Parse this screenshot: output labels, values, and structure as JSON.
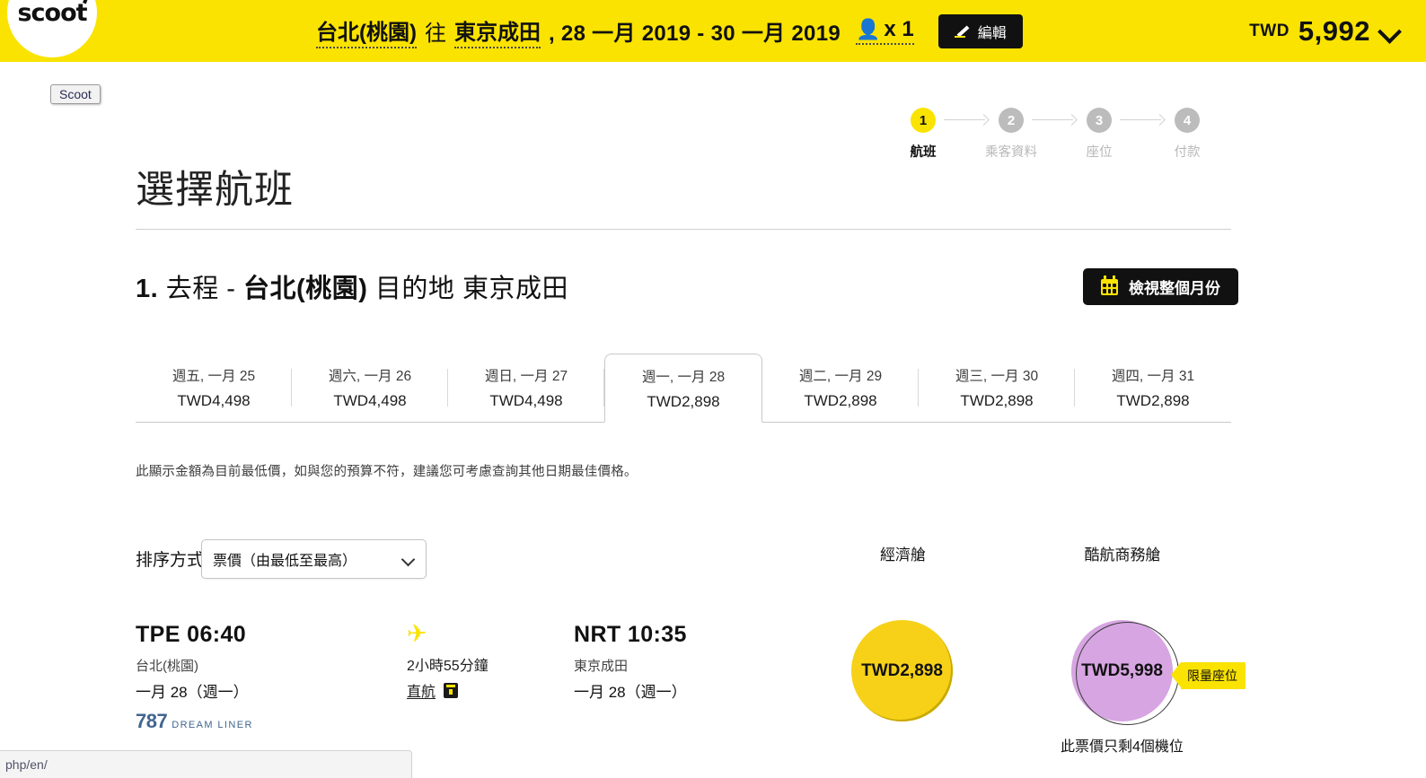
{
  "header": {
    "brand": "scoot",
    "origin": "台北(桃園)",
    "via": "往",
    "destination": "東京成田",
    "dates": ", 28 一月 2019 - 30 一月 2019",
    "pax_icon": "person-icon",
    "pax": "x 1",
    "edit_label": "編輯",
    "currency": "TWD",
    "total": "5,992",
    "chevron_icon": "chevron-down-icon"
  },
  "tooltip": {
    "text": "Scoot"
  },
  "stepper": {
    "steps": [
      {
        "num": "1",
        "label": "航班",
        "state": "active"
      },
      {
        "num": "2",
        "label": "乘客資料",
        "state": "idle"
      },
      {
        "num": "3",
        "label": "座位",
        "state": "idle"
      },
      {
        "num": "4",
        "label": "付款",
        "state": "idle"
      }
    ]
  },
  "page": {
    "title": "選擇航班",
    "section_num": "1.",
    "section_prefix": "去程 -",
    "section_origin": "台北(桃園)",
    "section_mid": "目的地",
    "section_destination": "東京成田",
    "month_button": "檢視整個月份",
    "month_button_icon": "calendar-icon",
    "note": "此顯示金額為目前最低價，如與您的預算不符，建議您可考慮查詢其他日期最佳價格。"
  },
  "date_tabs": [
    {
      "day": "週五, 一月 25",
      "price": "TWD4,498",
      "selected": false
    },
    {
      "day": "週六, 一月 26",
      "price": "TWD4,498",
      "selected": false
    },
    {
      "day": "週日, 一月 27",
      "price": "TWD4,498",
      "selected": false
    },
    {
      "day": "週一, 一月 28",
      "price": "TWD2,898",
      "selected": true
    },
    {
      "day": "週二, 一月 29",
      "price": "TWD2,898",
      "selected": false
    },
    {
      "day": "週三, 一月 30",
      "price": "TWD2,898",
      "selected": false
    },
    {
      "day": "週四, 一月 31",
      "price": "TWD2,898",
      "selected": false
    }
  ],
  "sort": {
    "label": "排序方式",
    "value": "票價（由最低至最高）",
    "chevron_icon": "chevron-down-icon"
  },
  "cabins": {
    "economy": "經濟艙",
    "business": "酷航商務艙"
  },
  "flight": {
    "depart": {
      "code": "TPE 06:40",
      "city": "台北(桃園)",
      "date": "一月 28（週一）",
      "aircraft_num": "787",
      "aircraft_word": "DREAM LINER"
    },
    "middle": {
      "plane_icon": "airplane-icon",
      "duration": "2小時55分鐘",
      "stops": "直航",
      "seat_icon": "seat-info-icon"
    },
    "arrive": {
      "code": "NRT 10:35",
      "city": "東京成田",
      "date": "一月 28（週一）"
    },
    "fares": {
      "economy_price": "TWD2,898",
      "business_price": "TWD5,998",
      "business_badge": "限量座位",
      "business_seats_left": "此票價只剩4個機位"
    }
  },
  "statusbar": {
    "url": "php/en/"
  },
  "colors": {
    "brand_yellow": "#FAE300",
    "fare_gold": "#F7D117",
    "fare_purple": "#D7A5E2",
    "dark": "#111111"
  }
}
